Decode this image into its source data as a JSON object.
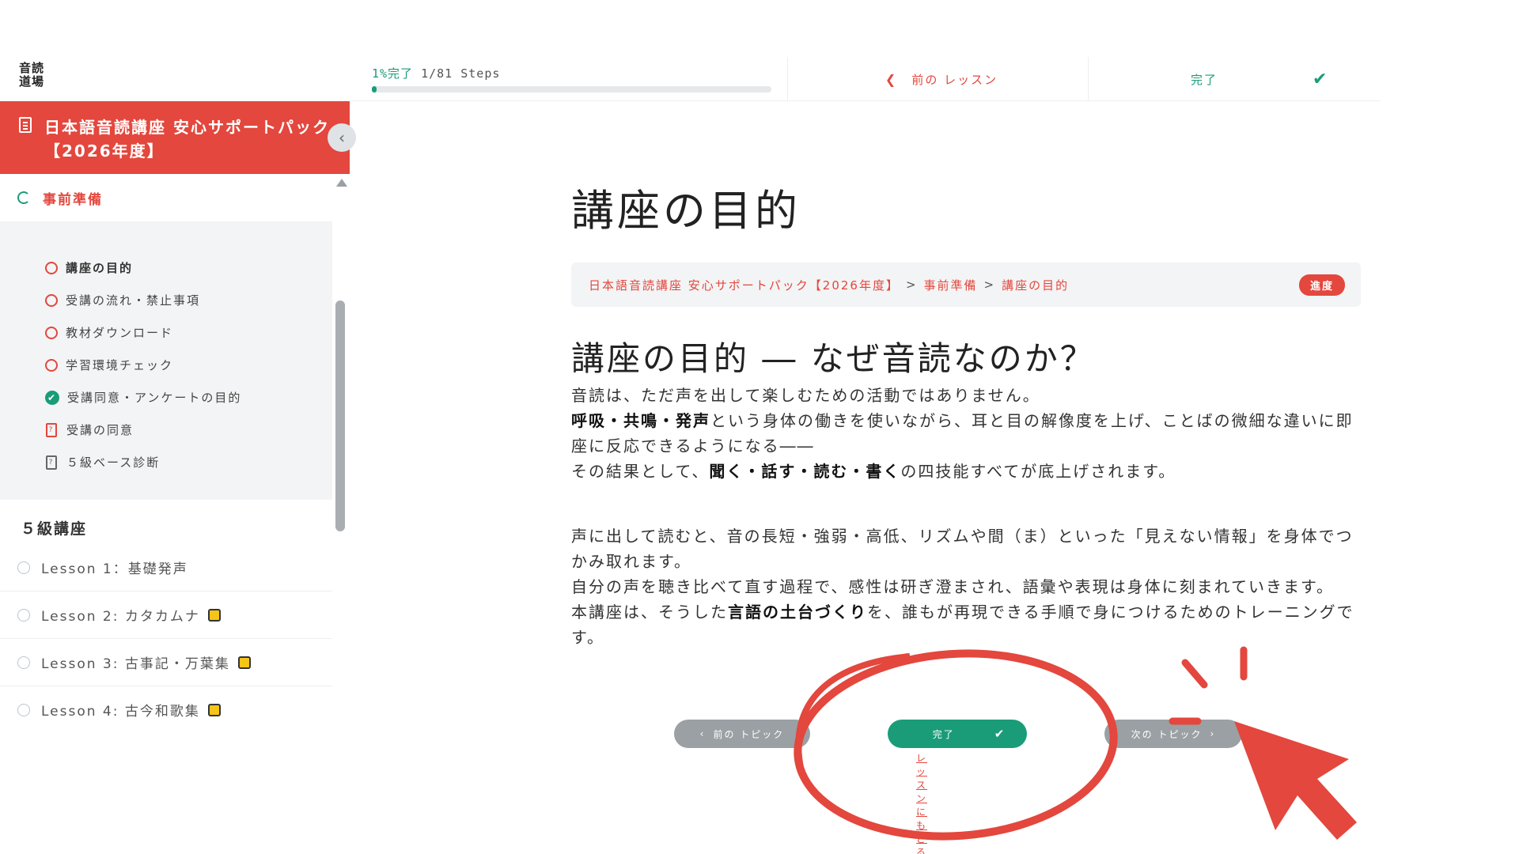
{
  "logo": {
    "line1": "音読",
    "line2": "道場"
  },
  "progress": {
    "percent_label": "1%完了",
    "steps_label": "1/81 Steps",
    "fraction": 0.0123
  },
  "topnav": {
    "prev_lesson": "前の レッスン",
    "complete": "完了"
  },
  "course": {
    "title": "日本語音読講座 安心サポートパック【2026年度】"
  },
  "section1": {
    "title": "事前準備",
    "topics": [
      {
        "label": "講座の目的",
        "state": "current"
      },
      {
        "label": "受講の流れ・禁止事項",
        "state": "open"
      },
      {
        "label": "教材ダウンロード",
        "state": "open"
      },
      {
        "label": "学習環境チェック",
        "state": "open"
      },
      {
        "label": "受講同意・アンケートの目的",
        "state": "done"
      },
      {
        "label": "受講の同意",
        "state": "quiz"
      },
      {
        "label": "５級ベース診断",
        "state": "quiz-gray"
      }
    ]
  },
  "section2": {
    "title": "５級講座",
    "lessons": [
      {
        "label": "Lesson 1：基礎発声",
        "locked": false
      },
      {
        "label": "Lesson 2: カタカムナ",
        "locked": true
      },
      {
        "label": "Lesson 3: 古事記・万葉集",
        "locked": true
      },
      {
        "label": "Lesson 4: 古今和歌集",
        "locked": true
      }
    ]
  },
  "main": {
    "page_title": "講座の目的",
    "breadcrumb": {
      "course": "日本語音読講座 安心サポートパック【2026年度】",
      "sep": ">",
      "section": "事前準備",
      "topic": "講座の目的",
      "badge": "進度"
    },
    "heading": "講座の目的 ― なぜ音読なのか？",
    "p1": "音読は、ただ声を出して楽しむための活動ではありません。",
    "p2_bold": "呼吸・共鳴・発声",
    "p2_rest": "という身体の働きを使いながら、耳と目の解像度を上げ、ことばの微細な違いに即座に反応できるようになる――",
    "p3_pre": "その結果として、",
    "p3_bold": "聞く・話す・読む・書く",
    "p3_post": "の四技能すべてが底上げされます。",
    "p4": "声に出して読むと、音の長短・強弱・高低、リズムや間（ま）といった「見えない情報」を身体でつかみ取れます。",
    "p5": "自分の声を聴き比べて直す過程で、感性は研ぎ澄まされ、語彙や表現は身体に刻まれていきます。",
    "p6_pre": "本講座は、そうした",
    "p6_bold": "言語の土台づくり",
    "p6_post": "を、誰もが再現できる手順で身につけるためのトレーニングです。"
  },
  "bottom_nav": {
    "prev_topic": "前の トピック",
    "complete": "完了",
    "next_topic": "次の トピック",
    "back_to_lesson": "レッスン にもどる"
  },
  "colors": {
    "accent": "#e3473d",
    "success": "#1a9c78",
    "gray_button": "#9aa0a4"
  }
}
